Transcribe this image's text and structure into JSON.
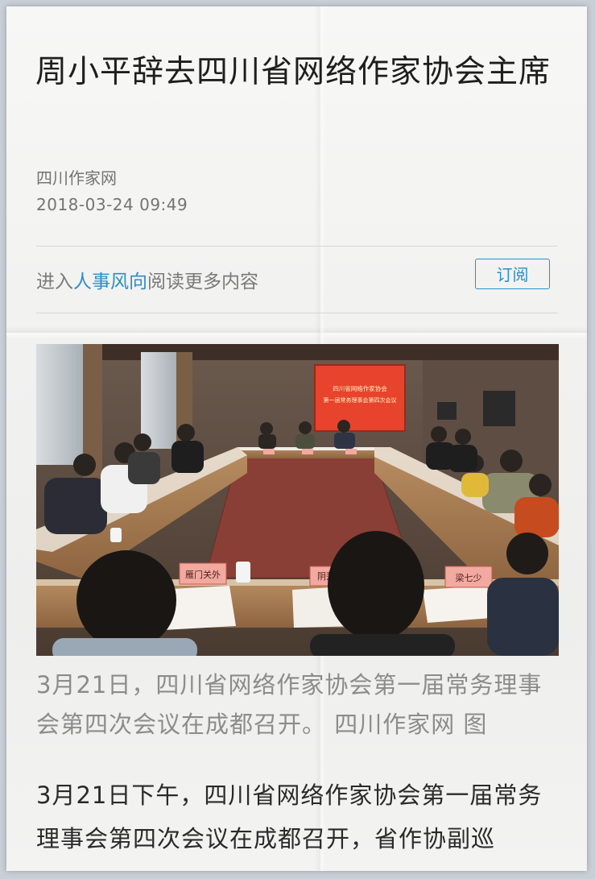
{
  "article": {
    "title": "周小平辞去四川省网络作家协会主席",
    "source": "四川作家网",
    "datetime": "2018-03-24  09:49"
  },
  "promo": {
    "prefix": "进入",
    "link": "人事风向",
    "suffix": "阅读更多内容",
    "subscribe_label": "订阅"
  },
  "photo": {
    "screen_line1": "四川省网络作家协会",
    "screen_line2": "第一届常务理事会第四次会议",
    "nameplate_left": "雁门关外",
    "nameplate_center": "阴落",
    "nameplate_right": "梁七少"
  },
  "caption": "3月21日，四川省网络作家协会第一届常务理事会第四次会议在成都召开。 四川作家网  图",
  "body": "3月21日下午，四川省网络作家协会第一届常务理事会第四次会议在成都召开，省作协副巡",
  "colors": {
    "accent": "#2c8ec8",
    "title": "#1e1e1e",
    "meta": "#747474"
  }
}
